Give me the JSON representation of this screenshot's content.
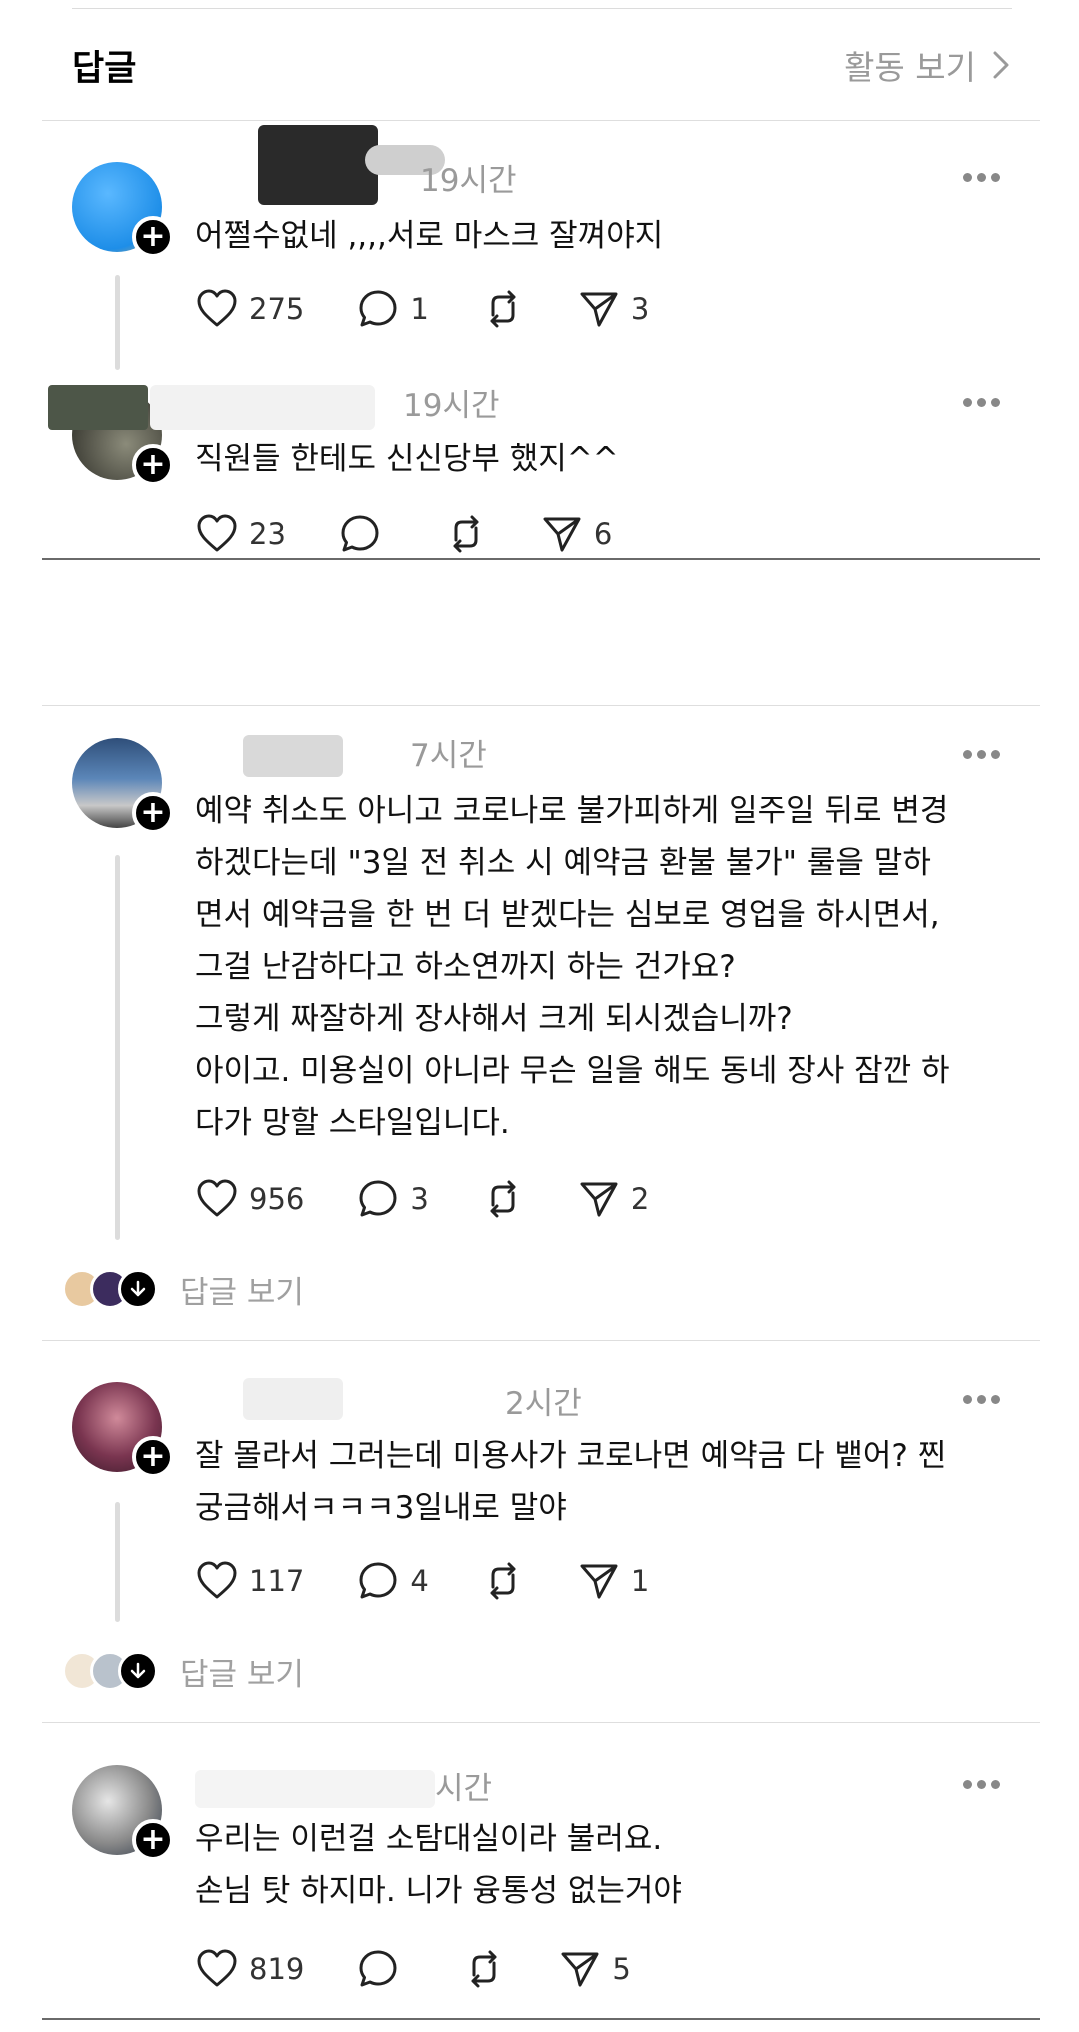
{
  "header": {
    "title": "답글",
    "activity_label": "활동 보기"
  },
  "posts": [
    {
      "time": "19시간",
      "text": [
        "어쩔수없네 ,,,,서로 마스크 잘껴야지"
      ],
      "likes": "275",
      "comments": "1",
      "shares": "3"
    },
    {
      "time": "19시간",
      "text": [
        "직원들 한테도 신신당부 했지^^"
      ],
      "likes": "23",
      "comments": "",
      "shares": "6"
    },
    {
      "time": "7시간",
      "text": [
        "예약 취소도 아니고 코로나로 불가피하게 일주일 뒤로 변경",
        "하겠다는데 \"3일 전 취소 시 예약금 환불 불가\" 룰을 말하",
        "면서 예약금을 한 번 더 받겠다는 심보로 영업을 하시면서,",
        "그걸 난감하다고 하소연까지 하는 건가요?",
        "그렇게 짜잘하게 장사해서 크게 되시겠습니까?",
        "아이고. 미용실이 아니라 무슨 일을 해도 동네 장사 잠깐 하",
        "다가 망할 스타일입니다."
      ],
      "likes": "956",
      "comments": "3",
      "shares": "2",
      "view_replies": "답글 보기"
    },
    {
      "time": "2시간",
      "text": [
        "잘 몰라서 그러는데 미용사가 코로나면 예약금 다 뱉어? 찐",
        "궁금해서ㅋㅋㅋ3일내로 말야"
      ],
      "likes": "117",
      "comments": "4",
      "shares": "1",
      "view_replies": "답글 보기"
    },
    {
      "time": "시간",
      "text": [
        "우리는 이런걸 소탐대실이라 불러요.",
        "손님 탓 하지마. 니가 융통성 없는거야"
      ],
      "likes": "819",
      "comments": "",
      "shares": "5"
    }
  ],
  "colors": {
    "muted": "#9a9a9a",
    "divider": "#dedede",
    "badge": "#000000"
  },
  "icons": [
    "heart-icon",
    "comment-icon",
    "repost-icon",
    "send-icon",
    "more-icon",
    "plus-icon",
    "chevron-right-icon",
    "arrow-down-icon"
  ]
}
